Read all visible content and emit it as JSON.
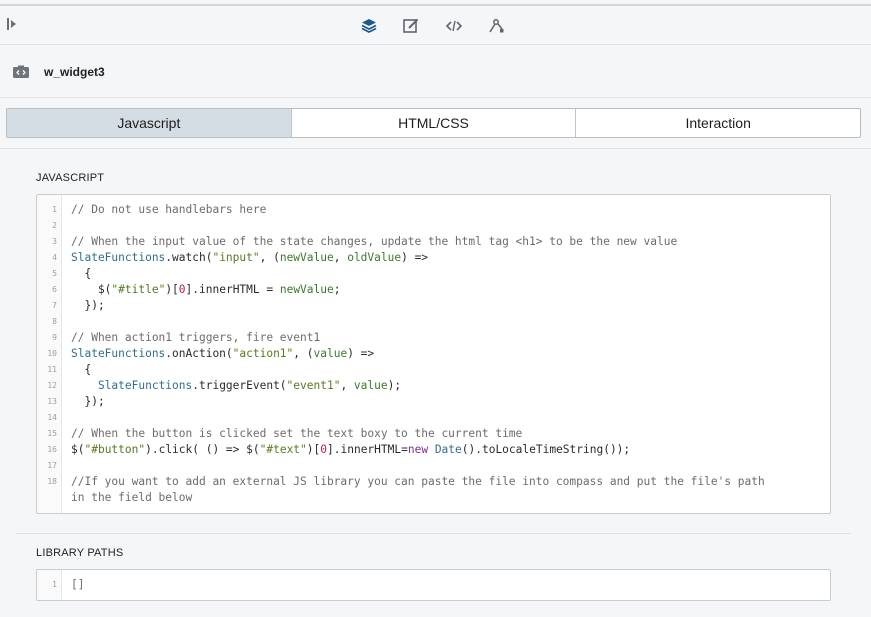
{
  "toolbar": {
    "icons": [
      "collapse-panel-icon",
      "layers-icon",
      "edit-icon",
      "code-icon",
      "interaction-icon"
    ]
  },
  "widget": {
    "icon": "widget-icon",
    "name": "w_widget3"
  },
  "tabs": [
    {
      "label": "Javascript",
      "active": true
    },
    {
      "label": "HTML/CSS",
      "active": false
    },
    {
      "label": "Interaction",
      "active": false
    }
  ],
  "javascript_section": {
    "label": "JAVASCRIPT",
    "lines": [
      {
        "n": "1",
        "text": "// Do not use handlebars here"
      },
      {
        "n": "2",
        "text": ""
      },
      {
        "n": "3",
        "text": "// When the input value of the state changes, update the html tag <h1> to be the new value"
      },
      {
        "n": "4",
        "text": "SlateFunctions.watch(\"input\", (newValue, oldValue) =>"
      },
      {
        "n": "5",
        "text": "  {"
      },
      {
        "n": "6",
        "text": "    $(\"#title\")[0].innerHTML = newValue;"
      },
      {
        "n": "7",
        "text": "  });"
      },
      {
        "n": "8",
        "text": ""
      },
      {
        "n": "9",
        "text": "// When action1 triggers, fire event1"
      },
      {
        "n": "10",
        "text": "SlateFunctions.onAction(\"action1\", (value) =>"
      },
      {
        "n": "11",
        "text": "  {"
      },
      {
        "n": "12",
        "text": "    SlateFunctions.triggerEvent(\"event1\", value);"
      },
      {
        "n": "13",
        "text": "  });"
      },
      {
        "n": "14",
        "text": ""
      },
      {
        "n": "15",
        "text": "// When the button is clicked set the text boxy to the current time"
      },
      {
        "n": "16",
        "text": "$(\"#button\").click( () => $(\"#text\")[0].innerHTML=new Date().toLocaleTimeString());"
      },
      {
        "n": "17",
        "text": ""
      },
      {
        "n": "18",
        "text": "//If you want to add an external JS library you can paste the file into compass and put the file's path"
      },
      {
        "n": "",
        "text": "in the field below"
      }
    ]
  },
  "library_section": {
    "label": "LIBRARY PATHS",
    "lines": [
      {
        "n": "1",
        "text": "[]"
      }
    ]
  }
}
